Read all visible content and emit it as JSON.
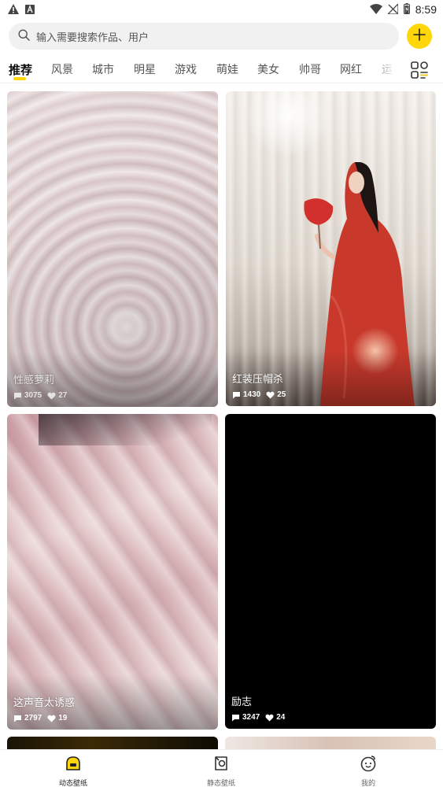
{
  "status_bar": {
    "time": "8:59",
    "left_icons": [
      "warning-icon",
      "notification-a-icon"
    ],
    "right_icons": [
      "wifi-icon",
      "no-signal-icon",
      "battery-icon"
    ]
  },
  "search": {
    "placeholder": "输入需要搜索作品、用户",
    "icon": "search-icon"
  },
  "add_button": {
    "icon": "plus-icon",
    "color": "#ffd60a"
  },
  "tabs": [
    {
      "label": "推荐",
      "active": true
    },
    {
      "label": "风景"
    },
    {
      "label": "城市"
    },
    {
      "label": "明星"
    },
    {
      "label": "游戏"
    },
    {
      "label": "萌娃"
    },
    {
      "label": "美女"
    },
    {
      "label": "帅哥"
    },
    {
      "label": "网红"
    },
    {
      "label": "运"
    }
  ],
  "accent_color": "#ffd60a",
  "cards": [
    {
      "title": "性感萝莉",
      "comments": "3075",
      "likes": "27"
    },
    {
      "title": "红装压帽杀",
      "comments": "1430",
      "likes": "25"
    },
    {
      "title": "这声音太诱惑",
      "comments": "2797",
      "likes": "19"
    },
    {
      "title": "励志",
      "comments": "3247",
      "likes": "24"
    }
  ],
  "bottom_nav": [
    {
      "label": "动态壁纸",
      "icon": "dynamic-wallpaper-icon",
      "active": true
    },
    {
      "label": "静态壁纸",
      "icon": "static-wallpaper-icon"
    },
    {
      "label": "我的",
      "icon": "profile-face-icon"
    }
  ]
}
